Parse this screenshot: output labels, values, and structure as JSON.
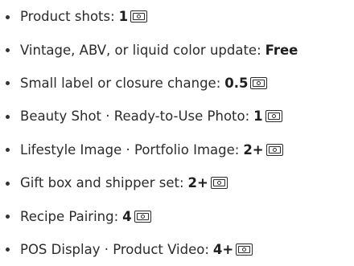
{
  "items": [
    {
      "label": "Product shots:",
      "value": "1",
      "icon": "credit-icon"
    },
    {
      "label": "Vintage, ABV, or liquid color update:",
      "value": "Free",
      "icon": ""
    },
    {
      "label": "Small label or closure change:",
      "value": "0.5",
      "icon": "credit-icon"
    },
    {
      "label": "Beauty Shot · Ready-to-Use Photo:",
      "value": "1",
      "icon": "credit-icon"
    },
    {
      "label": "Lifestyle Image · Portfolio Image:",
      "value": "2+",
      "icon": "credit-icon"
    },
    {
      "label": "Gift box and shipper set:",
      "value": "2+",
      "icon": "credit-icon"
    },
    {
      "label": "Recipe Pairing:",
      "value": "4",
      "icon": "credit-icon"
    },
    {
      "label": "POS Display · Product Video:",
      "value": "4+",
      "icon": "credit-icon"
    }
  ]
}
